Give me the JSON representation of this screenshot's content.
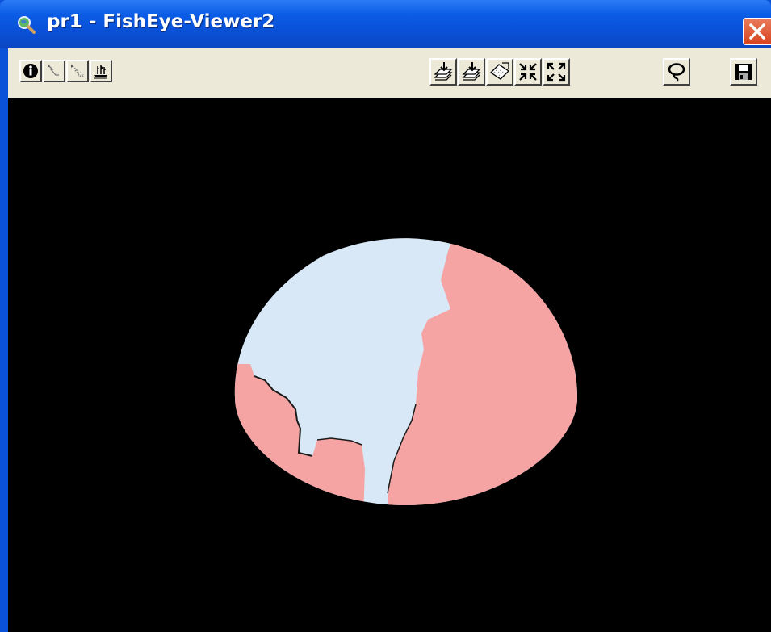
{
  "window": {
    "title": "pr1 - FishEye-Viewer2",
    "app_icon": "magnifier-globe-icon",
    "close_icon": "close-icon"
  },
  "toolbar": {
    "left_buttons": [
      {
        "name": "info-button",
        "icon": "info-icon"
      },
      {
        "name": "select-button",
        "icon": "pointer-outline-icon"
      },
      {
        "name": "select-dotted-button",
        "icon": "pointer-dotted-icon"
      },
      {
        "name": "ship-button",
        "icon": "ship-icon"
      }
    ],
    "right_buttons": [
      {
        "name": "import-button",
        "icon": "stack-download-icon"
      },
      {
        "name": "import-alt-button",
        "icon": "stack-download-alt-icon"
      },
      {
        "name": "pattern-button",
        "icon": "pattern-tile-icon"
      },
      {
        "name": "zoom-in-button",
        "icon": "arrows-inward-icon"
      },
      {
        "name": "zoom-out-button",
        "icon": "arrows-outward-icon"
      },
      {
        "name": "lasso-button",
        "icon": "lasso-icon"
      },
      {
        "name": "save-button",
        "icon": "floppy-disk-icon"
      }
    ]
  },
  "colors": {
    "background": "#000000",
    "dome_light": "#d8e8f6",
    "dome_pink": "#f5a3a3",
    "toolbar": "#ece9d8",
    "titlebar": "#0a52d8"
  }
}
